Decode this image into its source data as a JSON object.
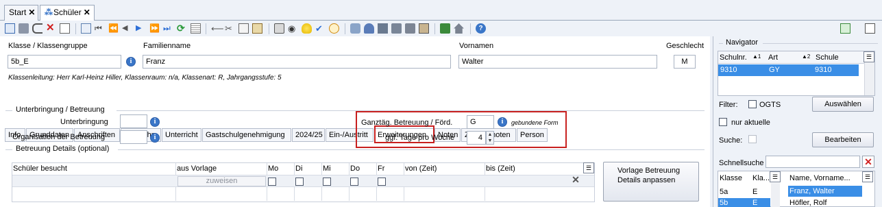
{
  "tabs": {
    "start": "Start",
    "schueler": "Schüler",
    "close": "✕"
  },
  "header": {
    "klasse_label": "Klasse / Klassengruppe",
    "klasse_value": "5b_E",
    "familienname_label": "Familienname",
    "familienname_value": "Franz",
    "vornamen_label": "Vornamen",
    "vornamen_value": "Walter",
    "geschlecht_label": "Geschlecht",
    "geschlecht_value": "M",
    "klassenleitung": "Klassenleitung: Herr Karl-Heinz Hiller, Klassenraum: n/a, Klassenart: R, Jahrgangsstufe: 5"
  },
  "page_tabs": [
    "Info",
    "Grunddaten",
    "Anschriften",
    "Laufbahn",
    "Unterricht",
    "Gastschulgenehmigung",
    "2024/25",
    "Ein-/Austritt",
    "Erweiterungen",
    "Noten",
    "Zeugnisnoten",
    "Person"
  ],
  "unterbringung": {
    "group_title": "Unterbringung / Betreuung",
    "unterbringung_label": "Unterbringung",
    "organisation_label": "Organisation der Betreuung",
    "ganztag_label": "Ganztäg. Betreuung / Förd.",
    "ganztag_value": "G",
    "ganztag_note": "gebundene Form",
    "tage_label": "ggf. Tage pro Woche",
    "tage_value": "4"
  },
  "details": {
    "group_title": "Betreuung Details (optional)",
    "columns": [
      "Schüler besucht",
      "aus Vorlage",
      "Mo",
      "Di",
      "Mi",
      "Do",
      "Fr",
      "von (Zeit)",
      "bis (Zeit)"
    ],
    "zuweisen": "zuweisen",
    "vorlage_button": "Vorlage Betreuung Details anpassen"
  },
  "navigator": {
    "title": "Navigator",
    "columns": [
      "Schulnr.",
      "Art",
      "Schule"
    ],
    "sort1": "▲1",
    "sort2": "▲2",
    "row": [
      "9310",
      "GY",
      "9310"
    ],
    "filter_label": "Filter:",
    "ogts_label": "OGTS",
    "auswaehlen": "Auswählen",
    "nur_aktuelle": "nur aktuelle",
    "suche_label": "Suche:",
    "bearbeiten": "Bearbeiten",
    "schnellsuche_label": "Schnellsuche",
    "list_columns": [
      "Klasse",
      "Kla...",
      "Name, Vorname..."
    ],
    "list_rows": [
      [
        "5a",
        "E",
        "Franz, Walter"
      ],
      [
        "5b",
        "E",
        "Höfler, Rolf"
      ]
    ]
  },
  "colors": {
    "accent": "#3a76c8",
    "red": "#c8201f",
    "selected": "#3a8ee6"
  }
}
